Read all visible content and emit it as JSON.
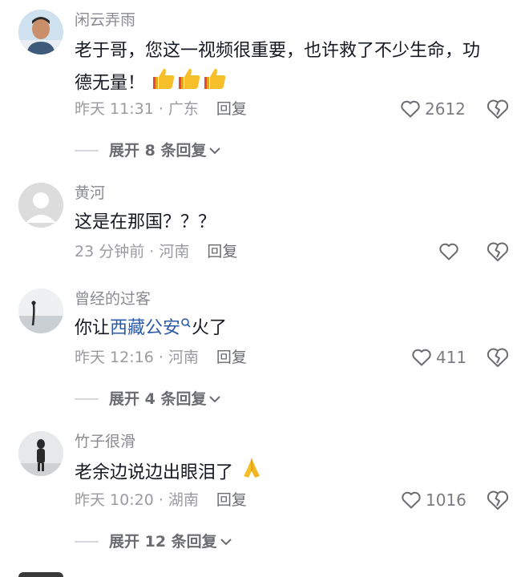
{
  "comments": [
    {
      "username": "闲云弄雨",
      "text_line1": "老于哥，您这一视频很重要，也许救了不少生命，功",
      "text_line2": "德无量！",
      "time": "昨天 11:31 · 广东",
      "reply": "回复",
      "likes": "2612",
      "replies_toggle": "展开 8 条回复"
    },
    {
      "username": "黄河",
      "text": "这是在那国？？？",
      "time": "23 分钟前 · 河南",
      "reply": "回复",
      "likes": ""
    },
    {
      "username": "曾经的过客",
      "text_before": "你让",
      "link": "西藏公安",
      "text_after": "火了",
      "time": "昨天 12:16 · 河南",
      "reply": "回复",
      "likes": "411",
      "replies_toggle": "展开 4 条回复"
    },
    {
      "username": "竹子很滑",
      "text": "老余边说边出眼泪了",
      "time": "昨天 10:20 · 湖南",
      "reply": "回复",
      "likes": "1016",
      "replies_toggle": "展开 12 条回复"
    }
  ],
  "icons": {
    "like": "heart-outline-icon",
    "dislike": "broken-heart-icon",
    "expand": "chevron-down-icon",
    "search": "search-icon"
  },
  "colors": {
    "username": "#8a8b91",
    "text": "#161823",
    "link": "#2b5aa9",
    "meta": "#9a9ba1"
  }
}
